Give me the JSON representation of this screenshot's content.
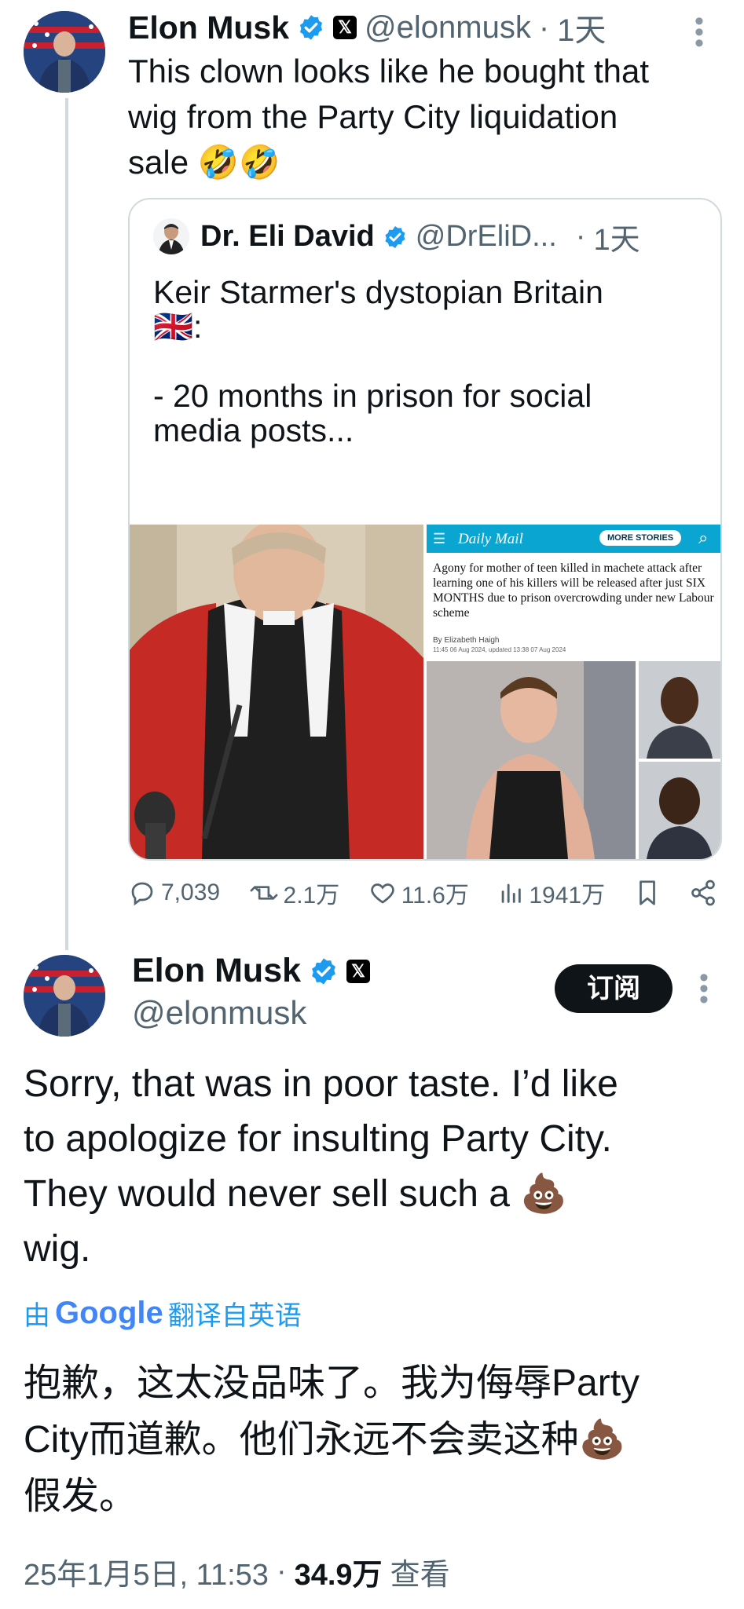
{
  "tweet1": {
    "name": "Elon Musk",
    "handle": "@elonmusk",
    "sep": "·",
    "time": "1天",
    "text_lines": [
      "This clown looks like he bought that",
      "wig from the Party City liquidation",
      "sale 🤣🤣"
    ]
  },
  "quote": {
    "name": "Dr. Eli David",
    "handle": "@DrEliD...",
    "sep": "·",
    "time": "1天",
    "text_lines": [
      "Keir Starmer's dystopian Britain",
      "🇬🇧:",
      "",
      "- 20 months in prison for social",
      "media posts..."
    ],
    "news": {
      "brand": "Daily Mail",
      "more_stories": "MORE STORIES",
      "headline": "Agony for mother of teen killed in machete attack after learning one of his killers will be released after just SIX MONTHS due to prison overcrowding under new Labour scheme",
      "byline": "By Elizabeth Haigh",
      "dateline": "11:45 06 Aug 2024, updated 13:38 07 Aug 2024"
    }
  },
  "actions": {
    "replies": "7,039",
    "reposts": "2.1万",
    "likes": "11.6万",
    "views": "1941万"
  },
  "tweet2": {
    "name": "Elon Musk",
    "handle": "@elonmusk",
    "subscribe": "订阅",
    "text_lines": [
      "Sorry, that was in poor taste. I’d like",
      "to apologize for insulting Party City.",
      "They would never sell such a 💩",
      "wig."
    ],
    "translate_prefix": "由",
    "translate_brand": "Google",
    "translate_suffix": "翻译自英语",
    "translation_lines": [
      "抱歉，这太没品味了。我为侮辱Party",
      "City而道歉。他们永远不会卖这种💩",
      "假发。"
    ],
    "timestamp": "25年1月5日, 11:53",
    "sep": "·",
    "views_count": "34.9万",
    "views_label": "查看"
  },
  "colors": {
    "verified": "#1d9bf0",
    "link": "#1d9bf0",
    "muted": "#536471",
    "subscribe_bg": "#0f1419"
  },
  "icons": [
    "verified-icon",
    "x-logo-icon",
    "more-icon",
    "reply-icon",
    "repost-icon",
    "like-icon",
    "views-icon",
    "bookmark-icon",
    "share-icon"
  ]
}
